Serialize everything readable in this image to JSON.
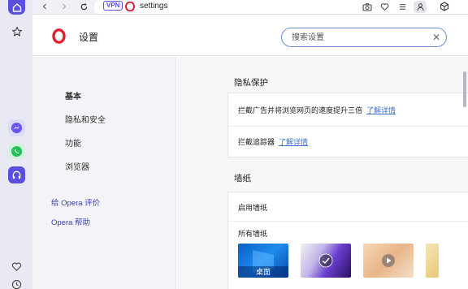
{
  "toolbar": {
    "vpn_label": "VPN",
    "url": "settings"
  },
  "header": {
    "title": "设置",
    "search_placeholder": "搜索设置",
    "clear_symbol": "✕"
  },
  "nav": {
    "items": [
      "基本",
      "隐私和安全",
      "功能",
      "浏览器"
    ],
    "links": [
      "给 Opera 评价",
      "Opera 帮助"
    ]
  },
  "privacy": {
    "title": "隐私保护",
    "rows": [
      {
        "text": "拦截广告并将浏览网页的速度提升三倍",
        "link": "了解详情"
      },
      {
        "text": "拦截追踪器",
        "link": "了解详情"
      }
    ]
  },
  "wallpaper": {
    "title": "墙纸",
    "enable_label": "启用墙纸",
    "all_label": "所有墙纸",
    "items": [
      {
        "name": "desktop",
        "label": "桌面",
        "selected": false
      },
      {
        "name": "purple-wave",
        "label": "",
        "selected": true
      },
      {
        "name": "warm-video",
        "label": "",
        "selected": false
      },
      {
        "name": "light-gold",
        "label": "",
        "selected": false
      }
    ]
  },
  "colors": {
    "accent": "#5b4fe0",
    "link": "#3b6fd6",
    "opera_red": "#e0202e"
  }
}
